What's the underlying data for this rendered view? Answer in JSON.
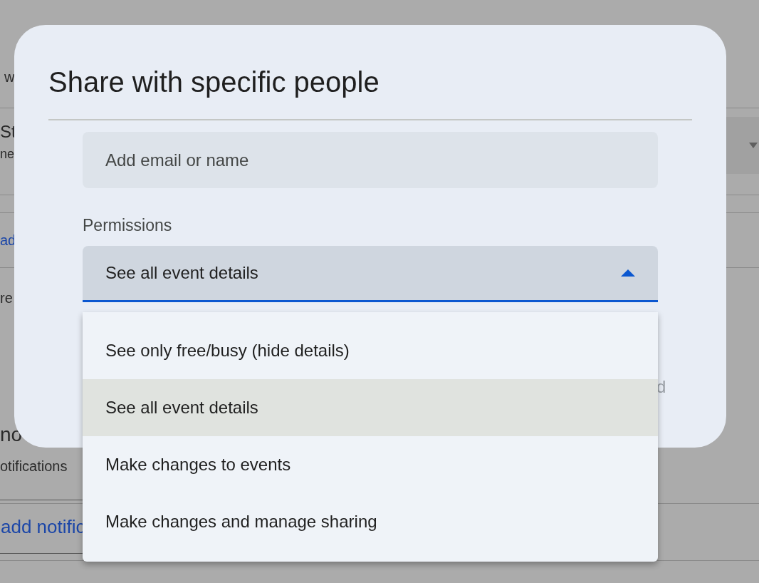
{
  "background": {
    "row_text_1": "w",
    "setting_title": "St",
    "setting_subtitle": "ne",
    "link": "ad",
    "row_text_2": "re",
    "section_heading": "no",
    "section_text": "otifications",
    "add_button": "add notific"
  },
  "dialog": {
    "title": "Share with specific people",
    "email_field": {
      "placeholder": "Add email or name"
    },
    "permissions": {
      "label": "Permissions",
      "value": "See all event details",
      "expanded": true
    },
    "button_fragment": "d",
    "options": [
      {
        "label": "See only free/busy (hide details)",
        "selected": false
      },
      {
        "label": "See all event details",
        "selected": true
      },
      {
        "label": "Make changes to events",
        "selected": false
      },
      {
        "label": "Make changes and manage sharing",
        "selected": false
      }
    ]
  }
}
